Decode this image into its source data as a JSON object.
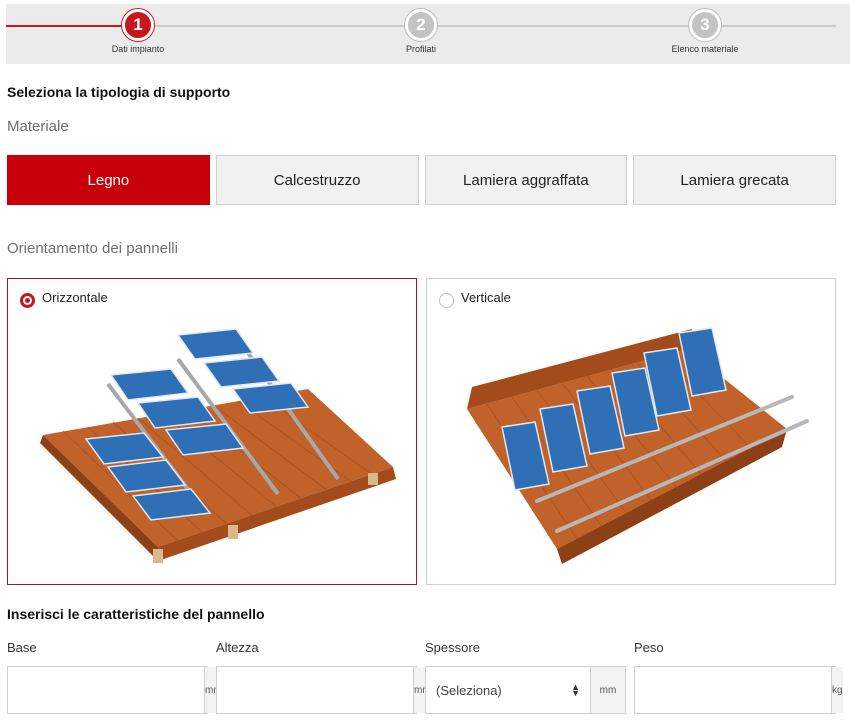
{
  "stepper": {
    "steps": [
      {
        "number": "1",
        "label": "Dati impianto",
        "state": "active"
      },
      {
        "number": "2",
        "label": "Profilati",
        "state": "inactive"
      },
      {
        "number": "3",
        "label": "Elenco materiale",
        "state": "inactive"
      }
    ]
  },
  "support": {
    "heading": "Seleziona la tipologia di supporto",
    "material_label": "Materiale",
    "materials": [
      "Legno",
      "Calcestruzzo",
      "Lamiera aggraffata",
      "Lamiera grecata"
    ],
    "selected_material": "Legno"
  },
  "orientation": {
    "label": "Orientamento dei pannelli",
    "options": [
      {
        "label": "Orizzontale",
        "selected": true
      },
      {
        "label": "Verticale",
        "selected": false
      }
    ]
  },
  "panel": {
    "heading": "Inserisci le caratteristiche del pannello",
    "fields": [
      {
        "label": "Base",
        "value": "",
        "unit": "mm"
      },
      {
        "label": "Altezza",
        "value": "",
        "unit": "mm"
      },
      {
        "label": "Spessore",
        "value": "(Seleziona)",
        "unit": "mm"
      },
      {
        "label": "Peso",
        "value": "",
        "unit": "kg"
      }
    ]
  },
  "colors": {
    "accent": "#c8161d",
    "roof": "#c0622a",
    "panel": "#2f6fb5"
  }
}
